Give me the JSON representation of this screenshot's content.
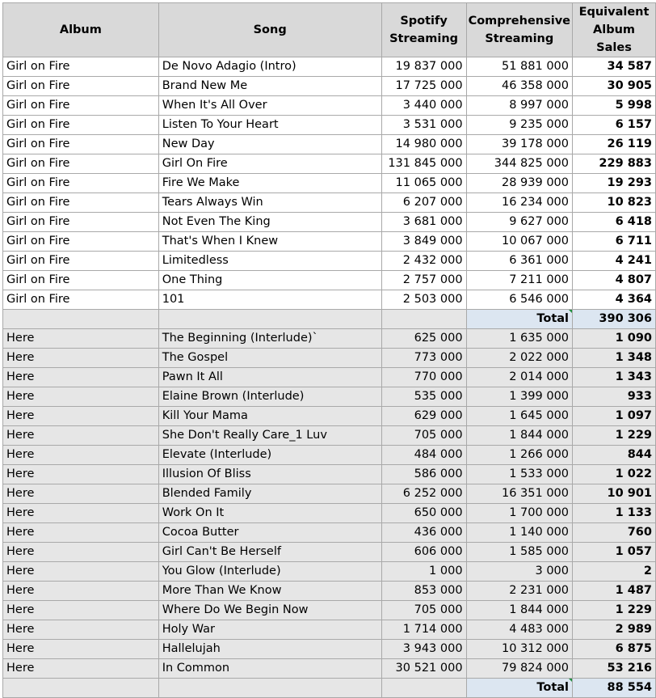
{
  "headers": {
    "album": "Album",
    "song": "Song",
    "spotify_1": "Spotify",
    "spotify_2": "Streaming",
    "comp_1": "Comprehensive",
    "comp_2": "Streaming",
    "eas_1": "Equivalent",
    "eas_2": "Album Sales"
  },
  "groups": [
    {
      "rows": [
        {
          "album": "Girl on Fire",
          "song": "De Novo Adagio (Intro)",
          "spotify": "19 837 000",
          "comprehensive": "51 881 000",
          "eas": "34 587"
        },
        {
          "album": "Girl on Fire",
          "song": "Brand New Me",
          "spotify": "17 725 000",
          "comprehensive": "46 358 000",
          "eas": "30 905"
        },
        {
          "album": "Girl on Fire",
          "song": "When It's All Over",
          "spotify": "3 440 000",
          "comprehensive": "8 997 000",
          "eas": "5 998"
        },
        {
          "album": "Girl on Fire",
          "song": "Listen To Your Heart",
          "spotify": "3 531 000",
          "comprehensive": "9 235 000",
          "eas": "6 157"
        },
        {
          "album": "Girl on Fire",
          "song": "New Day",
          "spotify": "14 980 000",
          "comprehensive": "39 178 000",
          "eas": "26 119"
        },
        {
          "album": "Girl on Fire",
          "song": "Girl On Fire",
          "spotify": "131 845 000",
          "comprehensive": "344 825 000",
          "eas": "229 883"
        },
        {
          "album": "Girl on Fire",
          "song": "Fire We Make",
          "spotify": "11 065 000",
          "comprehensive": "28 939 000",
          "eas": "19 293"
        },
        {
          "album": "Girl on Fire",
          "song": "Tears Always Win",
          "spotify": "6 207 000",
          "comprehensive": "16 234 000",
          "eas": "10 823"
        },
        {
          "album": "Girl on Fire",
          "song": "Not Even The King",
          "spotify": "3 681 000",
          "comprehensive": "9 627 000",
          "eas": "6 418"
        },
        {
          "album": "Girl on Fire",
          "song": "That's When I Knew",
          "spotify": "3 849 000",
          "comprehensive": "10 067 000",
          "eas": "6 711"
        },
        {
          "album": "Girl on Fire",
          "song": "Limitedless",
          "spotify": "2 432 000",
          "comprehensive": "6 361 000",
          "eas": "4 241"
        },
        {
          "album": "Girl on Fire",
          "song": "One Thing",
          "spotify": "2 757 000",
          "comprehensive": "7 211 000",
          "eas": "4 807"
        },
        {
          "album": "Girl on Fire",
          "song": "101",
          "spotify": "2 503 000",
          "comprehensive": "6 546 000",
          "eas": "4 364"
        }
      ],
      "total_label": "Total",
      "total_value": "390 306"
    },
    {
      "rows": [
        {
          "album": "Here",
          "song": "The Beginning (Interlude)`",
          "spotify": "625 000",
          "comprehensive": "1 635 000",
          "eas": "1 090"
        },
        {
          "album": "Here",
          "song": "The Gospel",
          "spotify": "773 000",
          "comprehensive": "2 022 000",
          "eas": "1 348"
        },
        {
          "album": "Here",
          "song": "Pawn It All",
          "spotify": "770 000",
          "comprehensive": "2 014 000",
          "eas": "1 343"
        },
        {
          "album": "Here",
          "song": "Elaine Brown (Interlude)",
          "spotify": "535 000",
          "comprehensive": "1 399 000",
          "eas": "933"
        },
        {
          "album": "Here",
          "song": "Kill Your Mama",
          "spotify": "629 000",
          "comprehensive": "1 645 000",
          "eas": "1 097"
        },
        {
          "album": "Here",
          "song": "She Don't Really Care_1 Luv",
          "spotify": "705 000",
          "comprehensive": "1 844 000",
          "eas": "1 229"
        },
        {
          "album": "Here",
          "song": "Elevate (Interlude)",
          "spotify": "484 000",
          "comprehensive": "1 266 000",
          "eas": "844"
        },
        {
          "album": "Here",
          "song": "Illusion Of Bliss",
          "spotify": "586 000",
          "comprehensive": "1 533 000",
          "eas": "1 022"
        },
        {
          "album": "Here",
          "song": "Blended Family",
          "spotify": "6 252 000",
          "comprehensive": "16 351 000",
          "eas": "10 901"
        },
        {
          "album": "Here",
          "song": "Work On It",
          "spotify": "650 000",
          "comprehensive": "1 700 000",
          "eas": "1 133"
        },
        {
          "album": "Here",
          "song": "Cocoa Butter",
          "spotify": "436 000",
          "comprehensive": "1 140 000",
          "eas": "760"
        },
        {
          "album": "Here",
          "song": "Girl Can't Be Herself",
          "spotify": "606 000",
          "comprehensive": "1 585 000",
          "eas": "1 057"
        },
        {
          "album": "Here",
          "song": "You Glow (Interlude)",
          "spotify": "1 000",
          "comprehensive": "3 000",
          "eas": "2"
        },
        {
          "album": "Here",
          "song": "More Than We Know",
          "spotify": "853 000",
          "comprehensive": "2 231 000",
          "eas": "1 487"
        },
        {
          "album": "Here",
          "song": "Where Do We Begin Now",
          "spotify": "705 000",
          "comprehensive": "1 844 000",
          "eas": "1 229"
        },
        {
          "album": "Here",
          "song": "Holy War",
          "spotify": "1 714 000",
          "comprehensive": "4 483 000",
          "eas": "2 989"
        },
        {
          "album": "Here",
          "song": "Hallelujah",
          "spotify": "3 943 000",
          "comprehensive": "10 312 000",
          "eas": "6 875"
        },
        {
          "album": "Here",
          "song": "In Common",
          "spotify": "30 521 000",
          "comprehensive": "79 824 000",
          "eas": "53 216"
        }
      ],
      "total_label": "Total",
      "total_value": "88 554"
    }
  ]
}
